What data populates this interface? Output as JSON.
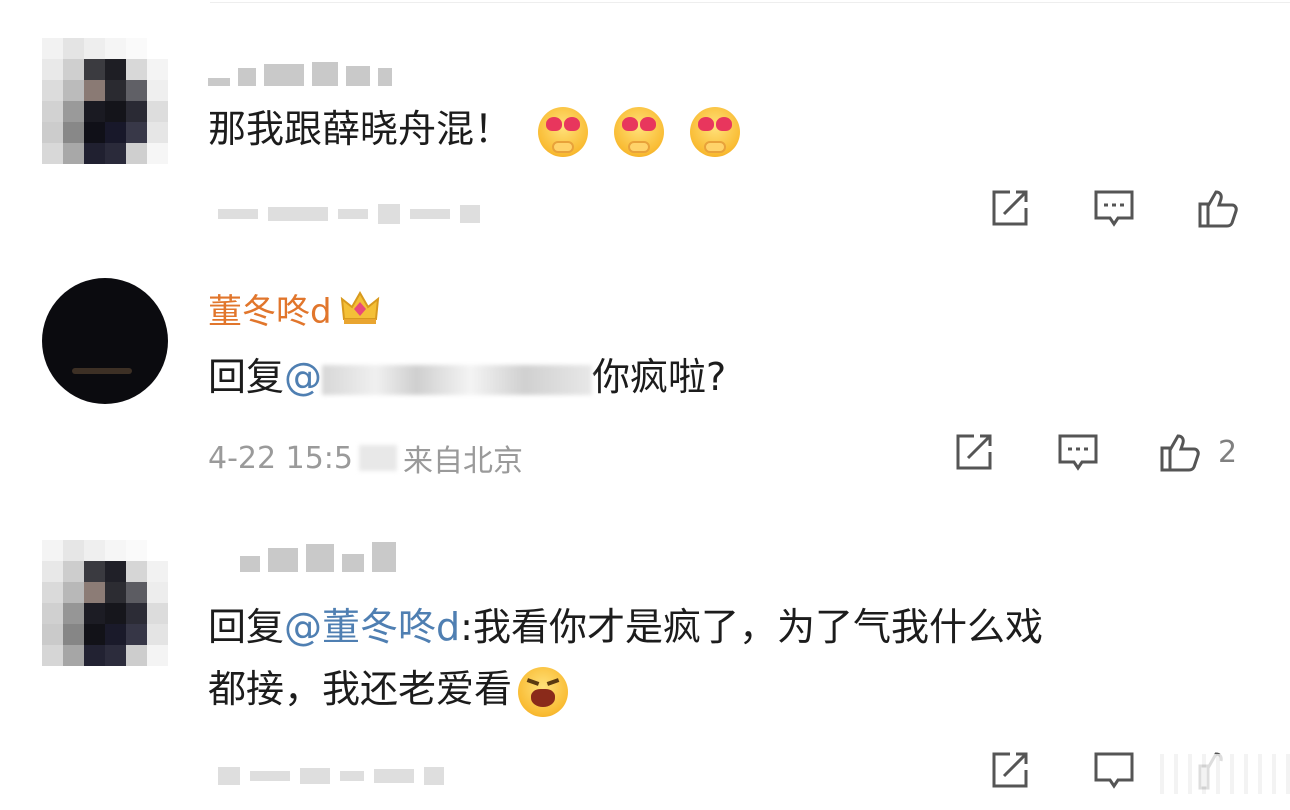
{
  "comments": [
    {
      "author_visible": false,
      "text": "那我跟薛晓舟混！",
      "actions": {
        "share_icon": "share-icon",
        "reply_icon": "comment-icon",
        "like_icon": "like-icon"
      }
    },
    {
      "author": "董冬咚d",
      "reply_prefix": "回复",
      "mention_at": "@",
      "text_after_mention": "你疯啦?",
      "meta": {
        "date": "4-22 15:5",
        "location_fragment": "来自北京"
      },
      "likes": "2"
    },
    {
      "author_visible": false,
      "reply_prefix": "回复",
      "mention": "@董冬咚d",
      "colon": ":",
      "line1": "我看你才是疯了，为了气我什么戏",
      "line2": "都接，我还老爱看"
    }
  ],
  "colors": {
    "author_orange": "#e1762c",
    "mention_blue": "#4f7fb2",
    "meta_gray": "#9a9a9a",
    "verified_badge": "#f7941e"
  }
}
